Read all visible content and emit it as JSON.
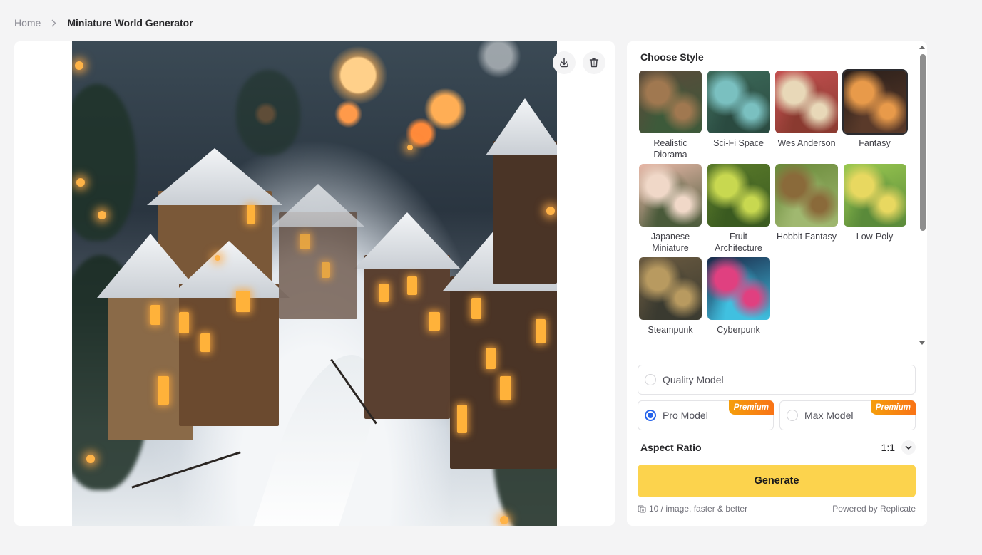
{
  "breadcrumb": {
    "home": "Home",
    "current": "Miniature World Generator"
  },
  "preview": {
    "download_icon": "download-icon",
    "delete_icon": "trash-icon"
  },
  "styles": {
    "title": "Choose Style",
    "items": [
      {
        "label": "Realistic Diorama",
        "colors": [
          "#5a4a3a",
          "#a07850",
          "#3d5a3a"
        ],
        "selected": false
      },
      {
        "label": "Sci-Fi Space",
        "colors": [
          "#3d6a5a",
          "#7ac0c0",
          "#2a4a40"
        ],
        "selected": false
      },
      {
        "label": "Wes Anderson",
        "colors": [
          "#c45050",
          "#e8d8b8",
          "#8a3a30"
        ],
        "selected": false
      },
      {
        "label": "Fantasy",
        "colors": [
          "#2a1f1a",
          "#e89a4a",
          "#5a3a2a"
        ],
        "selected": true
      },
      {
        "label": "Japanese Miniature",
        "colors": [
          "#e8b8a8",
          "#f0d8c8",
          "#4a5a3a"
        ],
        "selected": false
      },
      {
        "label": "Fruit Architecture",
        "colors": [
          "#5a7a2a",
          "#c8d850",
          "#3a5a20"
        ],
        "selected": false
      },
      {
        "label": "Hobbit Fantasy",
        "colors": [
          "#6a8a3a",
          "#8a6a3a",
          "#a0b870"
        ],
        "selected": false
      },
      {
        "label": "Low-Poly",
        "colors": [
          "#9ac850",
          "#e8d860",
          "#5a8a3a"
        ],
        "selected": false
      },
      {
        "label": "Steampunk",
        "colors": [
          "#6a5a40",
          "#b89a60",
          "#3a3a30"
        ],
        "selected": false
      },
      {
        "label": "Cyberpunk",
        "colors": [
          "#1a2a4a",
          "#e04080",
          "#40c0e0"
        ],
        "selected": false
      }
    ]
  },
  "models": [
    {
      "label": "Quality Model",
      "checked": false,
      "premium": false
    },
    {
      "label": "Pro Model",
      "checked": true,
      "premium": true,
      "badge": "Premium"
    },
    {
      "label": "Max Model",
      "checked": false,
      "premium": true,
      "badge": "Premium"
    }
  ],
  "aspect": {
    "label": "Aspect Ratio",
    "value": "1:1"
  },
  "generate": {
    "label": "Generate"
  },
  "footer": {
    "cost": "10 / image, faster & better",
    "powered": "Powered by Replicate"
  }
}
